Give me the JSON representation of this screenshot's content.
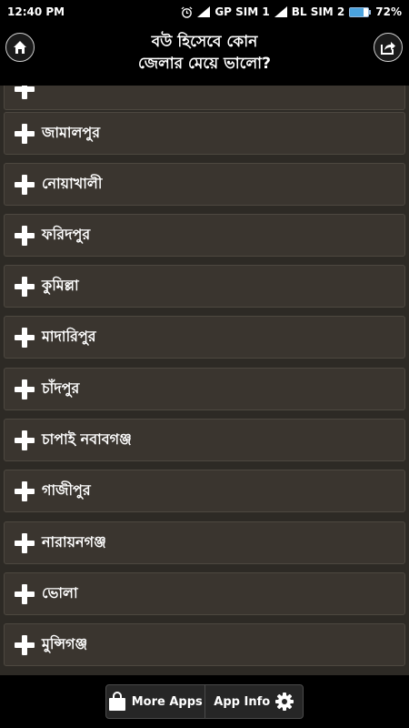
{
  "status": {
    "time": "12:40 PM",
    "sim1": "GP SIM 1",
    "sim2": "BL SIM 2",
    "battery": "72%",
    "battery_level": 0.72
  },
  "header": {
    "title_line1": "বউ হিসেবে কোন",
    "title_line2": "জেলার মেয়ে ভালো?",
    "home_icon": "home-icon",
    "share_icon": "share-icon"
  },
  "districts": [
    {
      "label": "জামালপুর"
    },
    {
      "label": "নোয়াখালী"
    },
    {
      "label": "ফরিদপুর"
    },
    {
      "label": "কুমিল্লা"
    },
    {
      "label": "মাদারিপুর"
    },
    {
      "label": "চাঁদপুর"
    },
    {
      "label": "চাপাই নবাবগঞ্জ"
    },
    {
      "label": "গাজীপুর"
    },
    {
      "label": "নারায়নগঞ্জ"
    },
    {
      "label": "ভোলা"
    },
    {
      "label": "মুন্সিগঞ্জ"
    }
  ],
  "footer": {
    "more_apps": "More Apps",
    "app_info": "App Info"
  },
  "colors": {
    "background": "#2d2a25",
    "row": "#3a352f",
    "bar": "#000000",
    "battery": "#4aa3df"
  }
}
